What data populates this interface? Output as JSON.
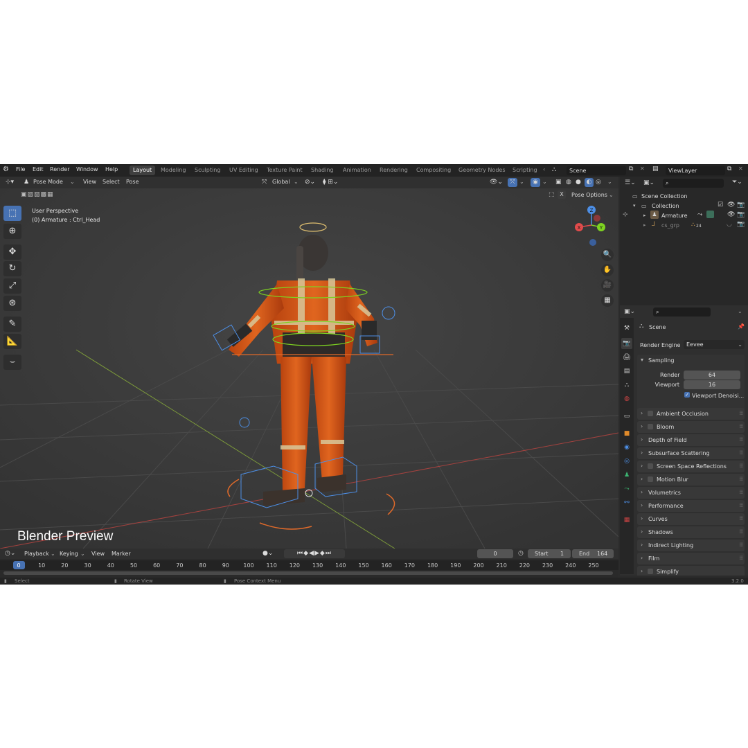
{
  "menu": [
    "File",
    "Edit",
    "Render",
    "Window",
    "Help"
  ],
  "workspaces": [
    "Layout",
    "Modeling",
    "Sculpting",
    "UV Editing",
    "Texture Paint",
    "Shading",
    "Animation",
    "Rendering",
    "Compositing",
    "Geometry Nodes",
    "Scripting"
  ],
  "scene_name": "Scene",
  "view_layer": "ViewLayer",
  "viewport": {
    "mode": "Pose Mode",
    "header_menus": [
      "View",
      "Select",
      "Pose"
    ],
    "transform_orientation": "Global",
    "pose_options": "Pose Options",
    "overlay_line1": "User Perspective",
    "overlay_line2": "(0) Armature : Ctrl_Head",
    "caption": "Blender Preview",
    "gizmo": {
      "x": "X",
      "y": "Y",
      "z": "Z"
    },
    "x_button": "X"
  },
  "outliner": {
    "scene_collection": "Scene Collection",
    "collection": "Collection",
    "armature": "Armature",
    "cs_grp": "cs_grp",
    "cs_count": "24"
  },
  "properties": {
    "scene_label": "Scene",
    "render_engine_label": "Render Engine",
    "render_engine_value": "Eevee",
    "sampling_label": "Sampling",
    "render_label": "Render",
    "render_value": "64",
    "viewport_label": "Viewport",
    "viewport_value": "16",
    "viewport_denoise": "Viewport Denoisi...",
    "panels": [
      {
        "label": "Ambient Occlusion",
        "checkbox": true
      },
      {
        "label": "Bloom",
        "checkbox": true
      },
      {
        "label": "Depth of Field",
        "checkbox": false
      },
      {
        "label": "Subsurface Scattering",
        "checkbox": false
      },
      {
        "label": "Screen Space Reflections",
        "checkbox": true
      },
      {
        "label": "Motion Blur",
        "checkbox": true
      },
      {
        "label": "Volumetrics",
        "checkbox": false
      },
      {
        "label": "Performance",
        "checkbox": false
      },
      {
        "label": "Curves",
        "checkbox": false
      },
      {
        "label": "Shadows",
        "checkbox": false
      },
      {
        "label": "Indirect Lighting",
        "checkbox": false
      },
      {
        "label": "Film",
        "checkbox": false
      },
      {
        "label": "Simplify",
        "checkbox": true
      }
    ]
  },
  "timeline": {
    "menus": [
      "Playback",
      "Keying",
      "View",
      "Marker"
    ],
    "current_frame": "0",
    "start_label": "Start",
    "start_value": "1",
    "end_label": "End",
    "end_value": "164",
    "ticks": [
      "0",
      "10",
      "20",
      "30",
      "40",
      "50",
      "60",
      "70",
      "80",
      "90",
      "100",
      "110",
      "120",
      "130",
      "140",
      "150",
      "160",
      "170",
      "180",
      "190",
      "200",
      "210",
      "220",
      "230",
      "240",
      "250"
    ]
  },
  "status": {
    "select": "Select",
    "rotate": "Rotate View",
    "context": "Pose Context Menu",
    "version": "3.2.0"
  },
  "colors": {
    "accent": "#4772b3",
    "suit_orange": "#d85a1a",
    "bone_green": "#6bd12a",
    "bone_blue": "#4d8fe6"
  }
}
